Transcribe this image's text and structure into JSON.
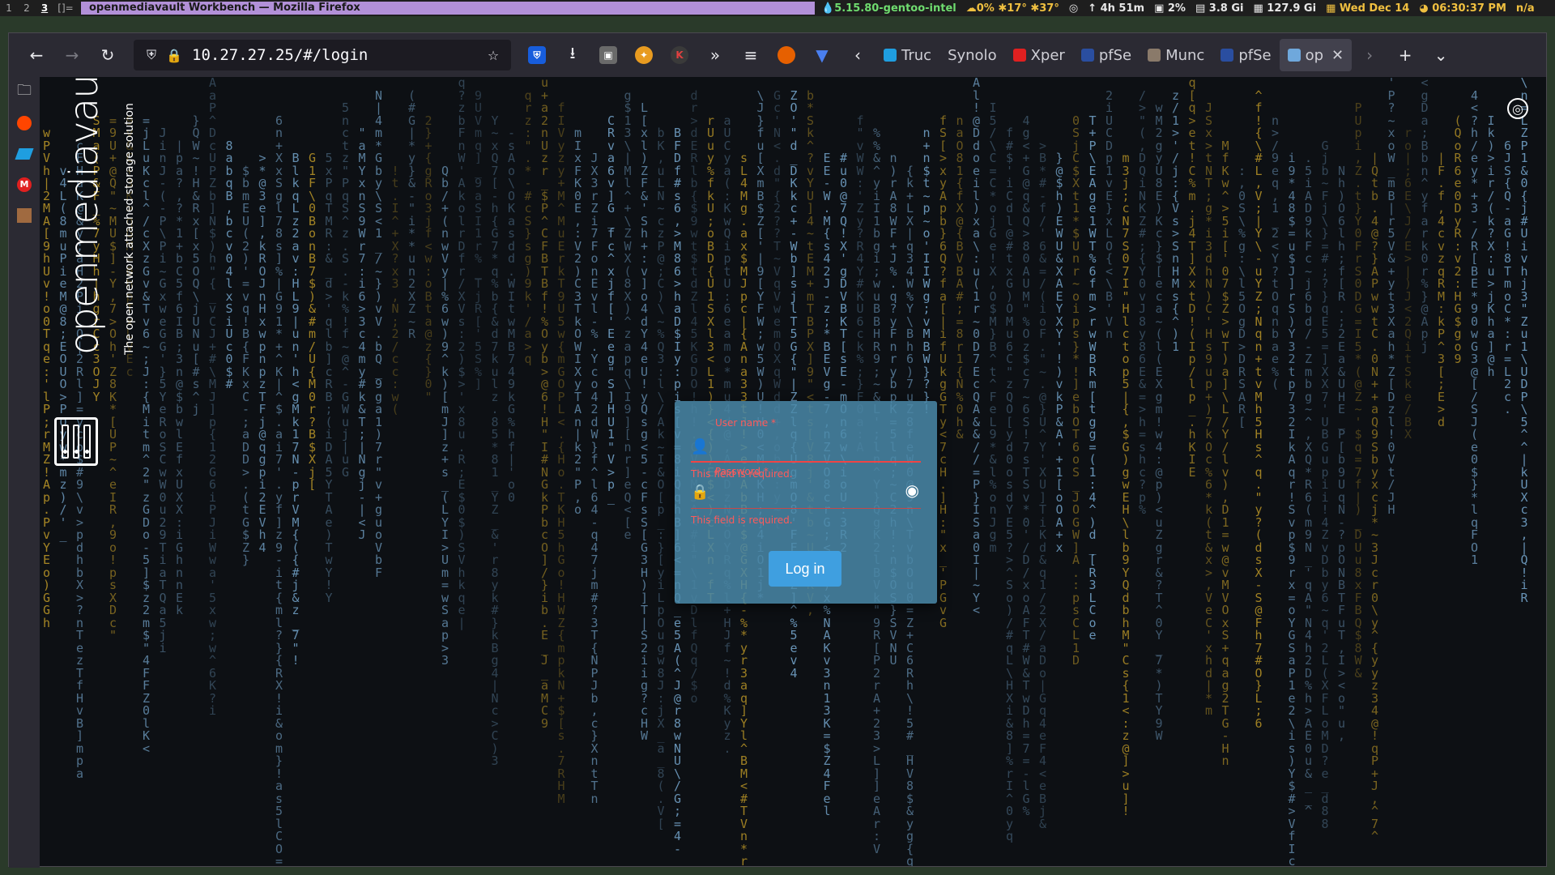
{
  "wm": {
    "workspaces": [
      "1",
      "2",
      "3"
    ],
    "active_workspace": "3",
    "layout_indicator": "[]=",
    "window_title": "openmediavault Workbench — Mozilla Firefox",
    "status": {
      "kernel": "5.15.80-gentoo-intel",
      "weather": "0% ✱17° ✱37°",
      "uptime": "4h 51m",
      "cpu": "2%",
      "mem": "3.8 Gi",
      "disk": "127.9 Gi",
      "date": "Wed Dec 14",
      "time": "06:30:37 PM",
      "extra": "n/a"
    },
    "colors": {
      "title_bg": "#b290d8",
      "kernel": "#6fdc6f",
      "weather": "#f0c040",
      "uptime": "#e8e8e8",
      "cpu": "#e8e8e8",
      "mem": "#e8e8e8",
      "disk": "#e8e8e8",
      "date": "#f0c040",
      "time": "#f0c040",
      "extra": "#f0c040"
    }
  },
  "browser": {
    "url": "10.27.27.25/#/login",
    "tabs": [
      {
        "label": "Truc",
        "favicon_color": "#1f9ee0"
      },
      {
        "label": "Synolo",
        "favicon_color": ""
      },
      {
        "label": "Xper",
        "favicon_color": "#e02020"
      },
      {
        "label": "pfSe",
        "favicon_color": "#2a4ea0"
      },
      {
        "label": "Munc",
        "favicon_color": "#8a7a6a"
      },
      {
        "label": "pfSe",
        "favicon_color": "#2a4ea0"
      },
      {
        "label": "op",
        "favicon_color": "#6fa8dc"
      }
    ],
    "extension_labels": {
      "k_badge": "K"
    }
  },
  "omv": {
    "wordmark": "openmediavault",
    "tagline": "The open network attached storage solution"
  },
  "login": {
    "username_label": "User name *",
    "username_value": "",
    "username_error": "This field is required.",
    "password_label": "Password *",
    "password_value": "",
    "password_error": "This field is required.",
    "submit_label": "Log in"
  },
  "icons": {
    "back": "arrow-left",
    "forward": "arrow-right",
    "reload": "reload",
    "shield": "shield",
    "lock": "lock",
    "bookmark": "star",
    "download": "download",
    "overflow": "chevrons-right",
    "menu": "hamburger",
    "user": "user",
    "password": "lock",
    "visibility": "eye",
    "language": "globe"
  }
}
